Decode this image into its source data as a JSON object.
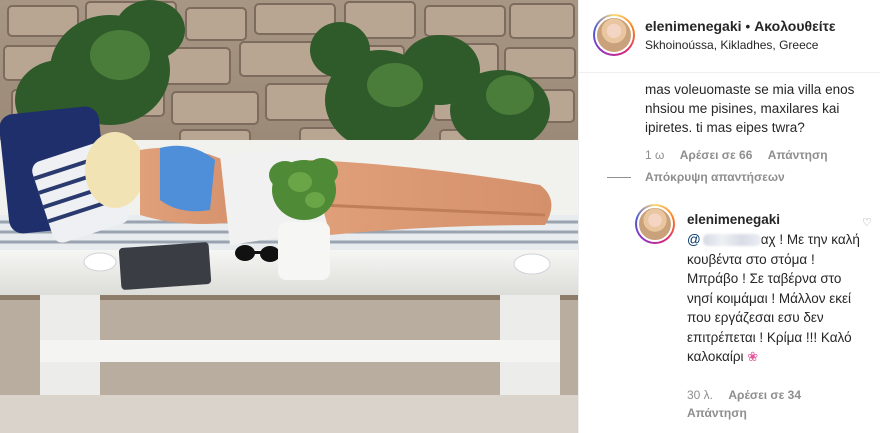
{
  "photo": {
    "description_icon": "post-photo"
  },
  "header": {
    "username": "elenimenegaki",
    "separator": "•",
    "follow_label": "Ακολουθείτε",
    "location": "Skhoinoússa, Kikladhes, Greece"
  },
  "comment1": {
    "text": "mas voleuomaste se mia villa enos nhsiou me pisines, maxilares kai ipiretes. ti mas eipes twra?",
    "age": "1 ω",
    "likes": "Αρέσει σε 66",
    "reply_label": "Απάντηση",
    "hide_replies": "Απόκρυψη απαντήσεων"
  },
  "reply": {
    "username": "elenimenegaki",
    "mention_prefix": "@",
    "mention_suffix": "αχ",
    "text": " ! Με την καλή κουβέντα στο στόμα ! Μπράβο ! Σε ταβέρνα στο νησί κοιμάμαι ! Μάλλον εκεί που εργάζεσαι εσυ δεν επιτρέπεται ! Κρίμα !!! Καλό καλοκαίρι ",
    "emoji": "❀",
    "age": "30 λ.",
    "likes": "Αρέσει σε 34",
    "reply_label": "Απάντηση"
  },
  "colors": {
    "text": "#262626",
    "muted": "#8e8e8e",
    "link": "#003569"
  }
}
